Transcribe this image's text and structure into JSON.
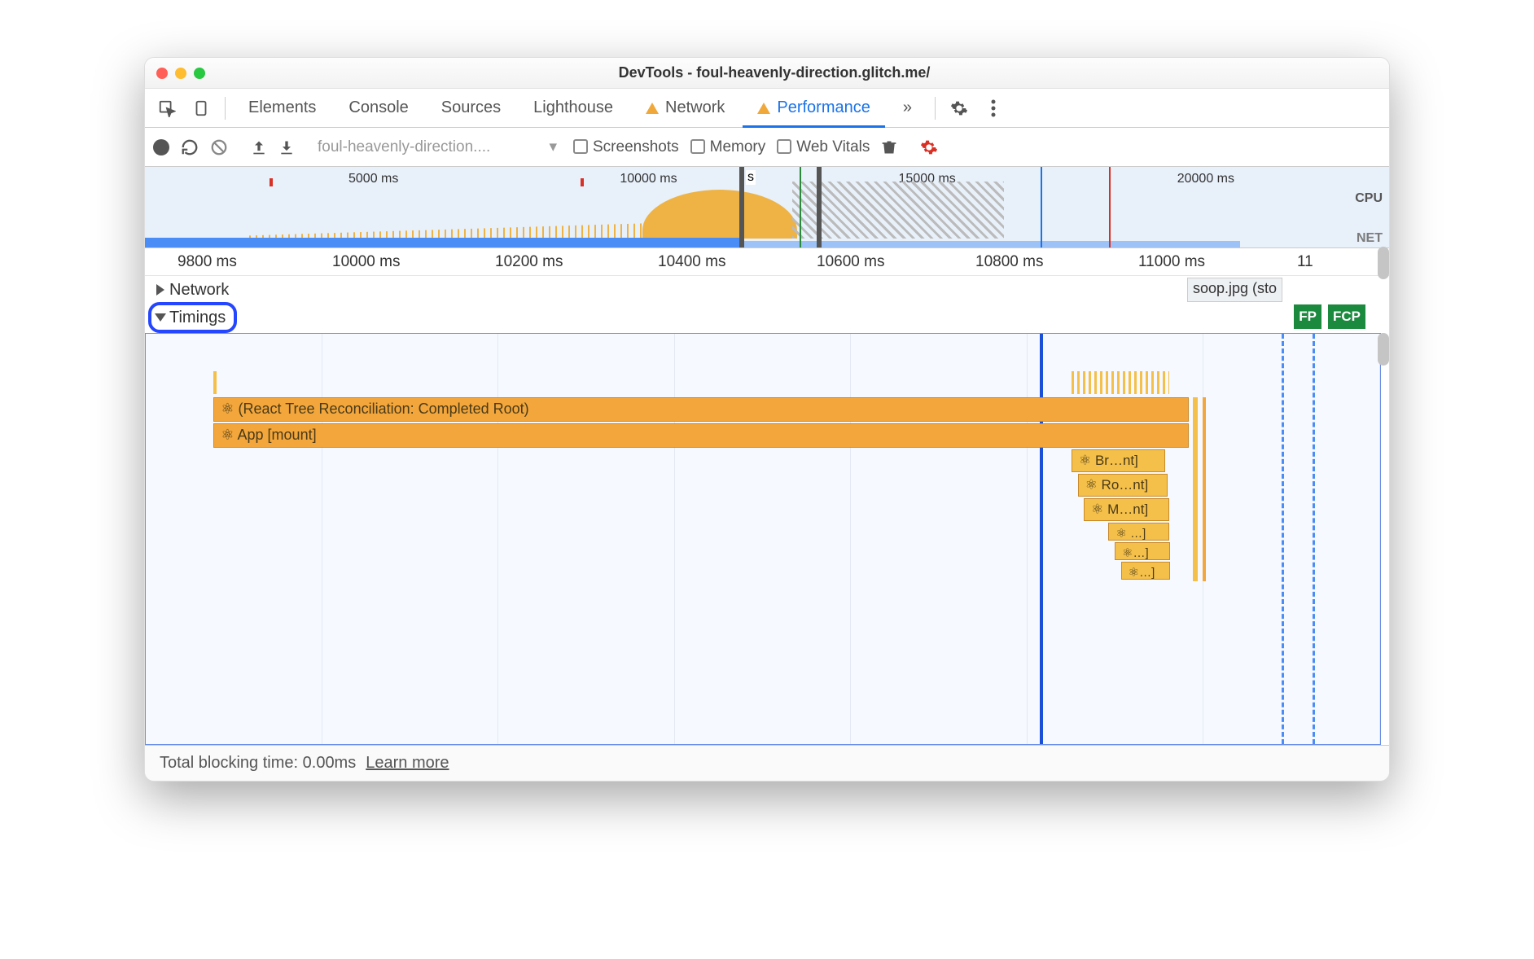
{
  "window": {
    "title": "DevTools - foul-heavenly-direction.glitch.me/"
  },
  "tabs": {
    "elements": "Elements",
    "console": "Console",
    "sources": "Sources",
    "lighthouse": "Lighthouse",
    "network": "Network",
    "performance": "Performance"
  },
  "toolbar": {
    "dropdown": "foul-heavenly-direction....",
    "screenshots": "Screenshots",
    "memory": "Memory",
    "webvitals": "Web Vitals"
  },
  "overview": {
    "ticks": [
      "5000 ms",
      "10000 ms",
      "15000 ms",
      "20000 ms"
    ],
    "cpu": "CPU",
    "net": "NET",
    "s": "s"
  },
  "ruler": {
    "t0": "9800 ms",
    "t1": "10000 ms",
    "t2": "10200 ms",
    "t3": "10400 ms",
    "t4": "10600 ms",
    "t5": "10800 ms",
    "t6": "11000 ms",
    "t7": "11"
  },
  "tracks": {
    "network": "Network",
    "timings": "Timings",
    "soop": "soop.jpg (sto",
    "fp": "FP",
    "fcp": "FCP"
  },
  "bars": {
    "recon": "⚛ (React Tree Reconciliation: Completed Root)",
    "app": "⚛ App [mount]",
    "br": "⚛ Br…nt]",
    "ro": "⚛ Ro…nt]",
    "m": "⚛ M…nt]",
    "d1": "⚛ …]",
    "d2": "⚛…]",
    "d3": "⚛…]"
  },
  "footer": {
    "tbt": "Total blocking time: 0.00ms",
    "learn": "Learn more"
  }
}
